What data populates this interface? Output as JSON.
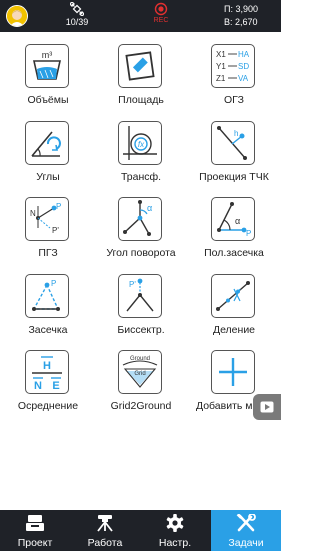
{
  "status": {
    "satellites": "10/39",
    "record_label": "REC",
    "p_value": "П: 3,900",
    "b_value": "В: 2,670",
    "colors": {
      "bar": "#1f2228",
      "record": "#e23030",
      "accent": "#2aa0e6"
    }
  },
  "tiles": [
    {
      "label": "Объёмы",
      "icon": "volume-icon"
    },
    {
      "label": "Площадь",
      "icon": "area-icon"
    },
    {
      "label": "ОГЗ",
      "icon": "inverse-geodetic-icon",
      "icon_text": {
        "x1": "X1",
        "ha": "HA",
        "y1": "Y1",
        "sd": "SD",
        "z1": "Z1",
        "va": "VA"
      }
    },
    {
      "label": "Углы",
      "icon": "angles-icon"
    },
    {
      "label": "Трансф.",
      "icon": "transform-icon",
      "icon_text": {
        "fx": "fx"
      }
    },
    {
      "label": "Проекция ТЧК",
      "icon": "point-projection-icon",
      "icon_text": {
        "h": "h"
      }
    },
    {
      "label": "ПГЗ",
      "icon": "direct-geodetic-icon",
      "icon_text": {
        "n": "N",
        "p": "P",
        "pp": "P'"
      }
    },
    {
      "label": "Угол поворота",
      "icon": "rotation-angle-icon",
      "icon_text": {
        "a": "α"
      }
    },
    {
      "label": "Пол.засечка",
      "icon": "polar-intersection-icon",
      "icon_text": {
        "a": "α",
        "p": "P"
      }
    },
    {
      "label": "Засечка",
      "icon": "intersection-icon",
      "icon_text": {
        "p": "P"
      }
    },
    {
      "label": "Биссектр.",
      "icon": "bisector-icon",
      "icon_text": {
        "pp": "P'"
      }
    },
    {
      "label": "Деление",
      "icon": "divide-icon"
    },
    {
      "label": "Осреднение",
      "icon": "averaging-icon",
      "icon_text": {
        "h": "H",
        "n": "N",
        "e": "E"
      }
    },
    {
      "label": "Grid2Ground",
      "icon": "grid-to-ground-icon",
      "icon_text": {
        "ground": "Ground",
        "grid": "Grid"
      }
    },
    {
      "label": "Добавить меню",
      "icon": "add-menu-icon"
    }
  ],
  "nav": [
    {
      "label": "Проект",
      "icon": "project-icon",
      "active": false
    },
    {
      "label": "Работа",
      "icon": "survey-work-icon",
      "active": false
    },
    {
      "label": "Настр.",
      "icon": "settings-gear-icon",
      "active": false
    },
    {
      "label": "Задачи",
      "icon": "tools-icon",
      "active": true
    }
  ]
}
